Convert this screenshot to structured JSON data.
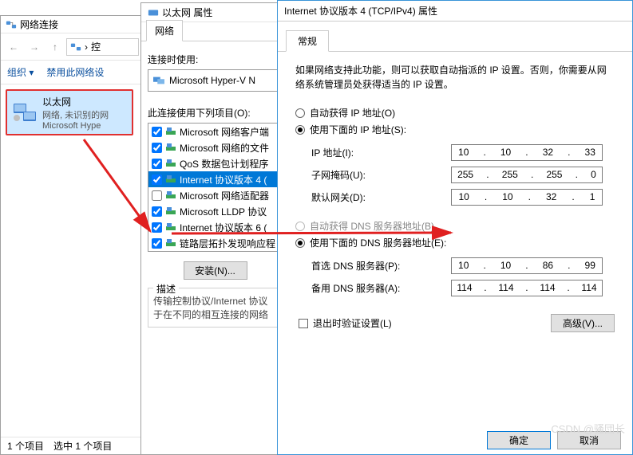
{
  "netconn": {
    "title": "网络连接",
    "address": "控",
    "cmd_organize": "组织 ▾",
    "cmd_disable": "禁用此网络设",
    "item": {
      "name": "以太网",
      "line2": "网络, 未识别的网",
      "line3": "Microsoft Hype"
    },
    "status_left": "1 个项目",
    "status_right": "选中 1 个项目"
  },
  "ethprop": {
    "title": "以太网 属性",
    "tab": "网络",
    "connect_using": "连接时使用:",
    "adapter": "Microsoft Hyper-V N",
    "items_label": "此连接使用下列项目(O):",
    "items": [
      {
        "checked": true,
        "label": "Microsoft 网络客户端"
      },
      {
        "checked": true,
        "label": "Microsoft 网络的文件"
      },
      {
        "checked": true,
        "label": "QoS 数据包计划程序"
      },
      {
        "checked": true,
        "label": "Internet 协议版本 4 (",
        "selected": true
      },
      {
        "checked": false,
        "label": "Microsoft 网络适配器"
      },
      {
        "checked": true,
        "label": "Microsoft LLDP 协议"
      },
      {
        "checked": true,
        "label": "Internet 协议版本 6 ("
      },
      {
        "checked": true,
        "label": "链路层拓扑发现响应程"
      }
    ],
    "install_btn": "安装(N)...",
    "desc_title": "描述",
    "desc_body": "传输控制协议/Internet 协议于在不同的相互连接的网络"
  },
  "ipv4": {
    "title": "Internet 协议版本 4 (TCP/IPv4) 属性",
    "tab": "常规",
    "help": "如果网络支持此功能，则可以获取自动指派的 IP 设置。否则，你需要从网络系统管理员处获得适当的 IP 设置。",
    "auto_ip": "自动获得 IP 地址(O)",
    "use_ip": "使用下面的 IP 地址(S):",
    "ip_label": "IP 地址(I):",
    "ip": [
      "10",
      "10",
      "32",
      "33"
    ],
    "mask_label": "子网掩码(U):",
    "mask": [
      "255",
      "255",
      "255",
      "0"
    ],
    "gw_label": "默认网关(D):",
    "gw": [
      "10",
      "10",
      "32",
      "1"
    ],
    "auto_dns": "自动获得 DNS 服务器地址(B)",
    "use_dns": "使用下面的 DNS 服务器地址(E):",
    "dns1_label": "首选 DNS 服务器(P):",
    "dns1": [
      "10",
      "10",
      "86",
      "99"
    ],
    "dns2_label": "备用 DNS 服务器(A):",
    "dns2": [
      "114",
      "114",
      "114",
      "114"
    ],
    "validate": "退出时验证设置(L)",
    "advanced": "高级(V)...",
    "ok": "确定",
    "cancel": "取消"
  },
  "watermark": "CSDN @骚団长"
}
